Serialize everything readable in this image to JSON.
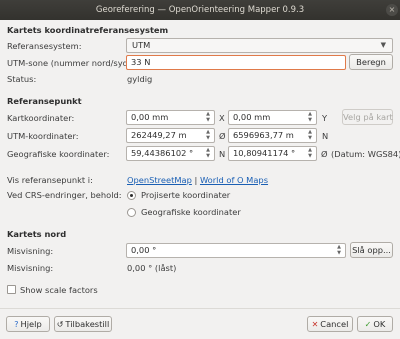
{
  "window": {
    "title": "Georeferering — OpenOrienteering Mapper 0.9.3",
    "close_glyph": "×"
  },
  "map_crs": {
    "section": "Kartets koordinatreferansesystem",
    "crs_label": "Referansesystem:",
    "crs_value": "UTM",
    "zone_label": "UTM-sone (nummer nord/syd):",
    "zone_value": "33 N",
    "lookup_button": "Beregn",
    "status_label": "Status:",
    "status_value": "gyldig"
  },
  "ref_point": {
    "section": "Referansepunkt",
    "map_coords_label": "Kartkoordinater:",
    "map_x": "0,00 mm",
    "map_x_axis": "X",
    "map_y": "0,00 mm",
    "map_y_axis": "Y",
    "pick_button": "Velg på kart",
    "utm_label": "UTM-koordinater:",
    "easting": "262449,27 m",
    "easting_axis": "Ø",
    "northing": "6596963,77 m",
    "northing_axis": "N",
    "geo_label": "Geografiske koordinater:",
    "latitude": "59,44386102 °",
    "latitude_axis": "N",
    "longitude": "10,80941174 °",
    "longitude_axis": "Ø",
    "datum_note": "(Datum: WGS84)",
    "show_label": "Vis referansepunkt i:",
    "link_osm": "OpenStreetMap",
    "link_separator": "|",
    "link_woom": "World of O Maps",
    "keep_label": "Ved CRS-endringer, behold:",
    "option_projected": "Projiserte koordinater",
    "option_geographic": "Geografiske koordinater",
    "selected_option": "projected"
  },
  "map_north": {
    "section": "Kartets nord",
    "declination_label": "Misvisning:",
    "declination_value": "0,00 °",
    "lookup_button": "Slå opp...",
    "grivation_label": "Misvisning:",
    "grivation_value": "0,00 ° (låst)"
  },
  "scale_factors": {
    "label": "Show scale factors",
    "checked": false
  },
  "footer": {
    "help": "Hjelp",
    "reset": "Tilbakestill",
    "cancel": "Cancel",
    "ok": "OK"
  }
}
